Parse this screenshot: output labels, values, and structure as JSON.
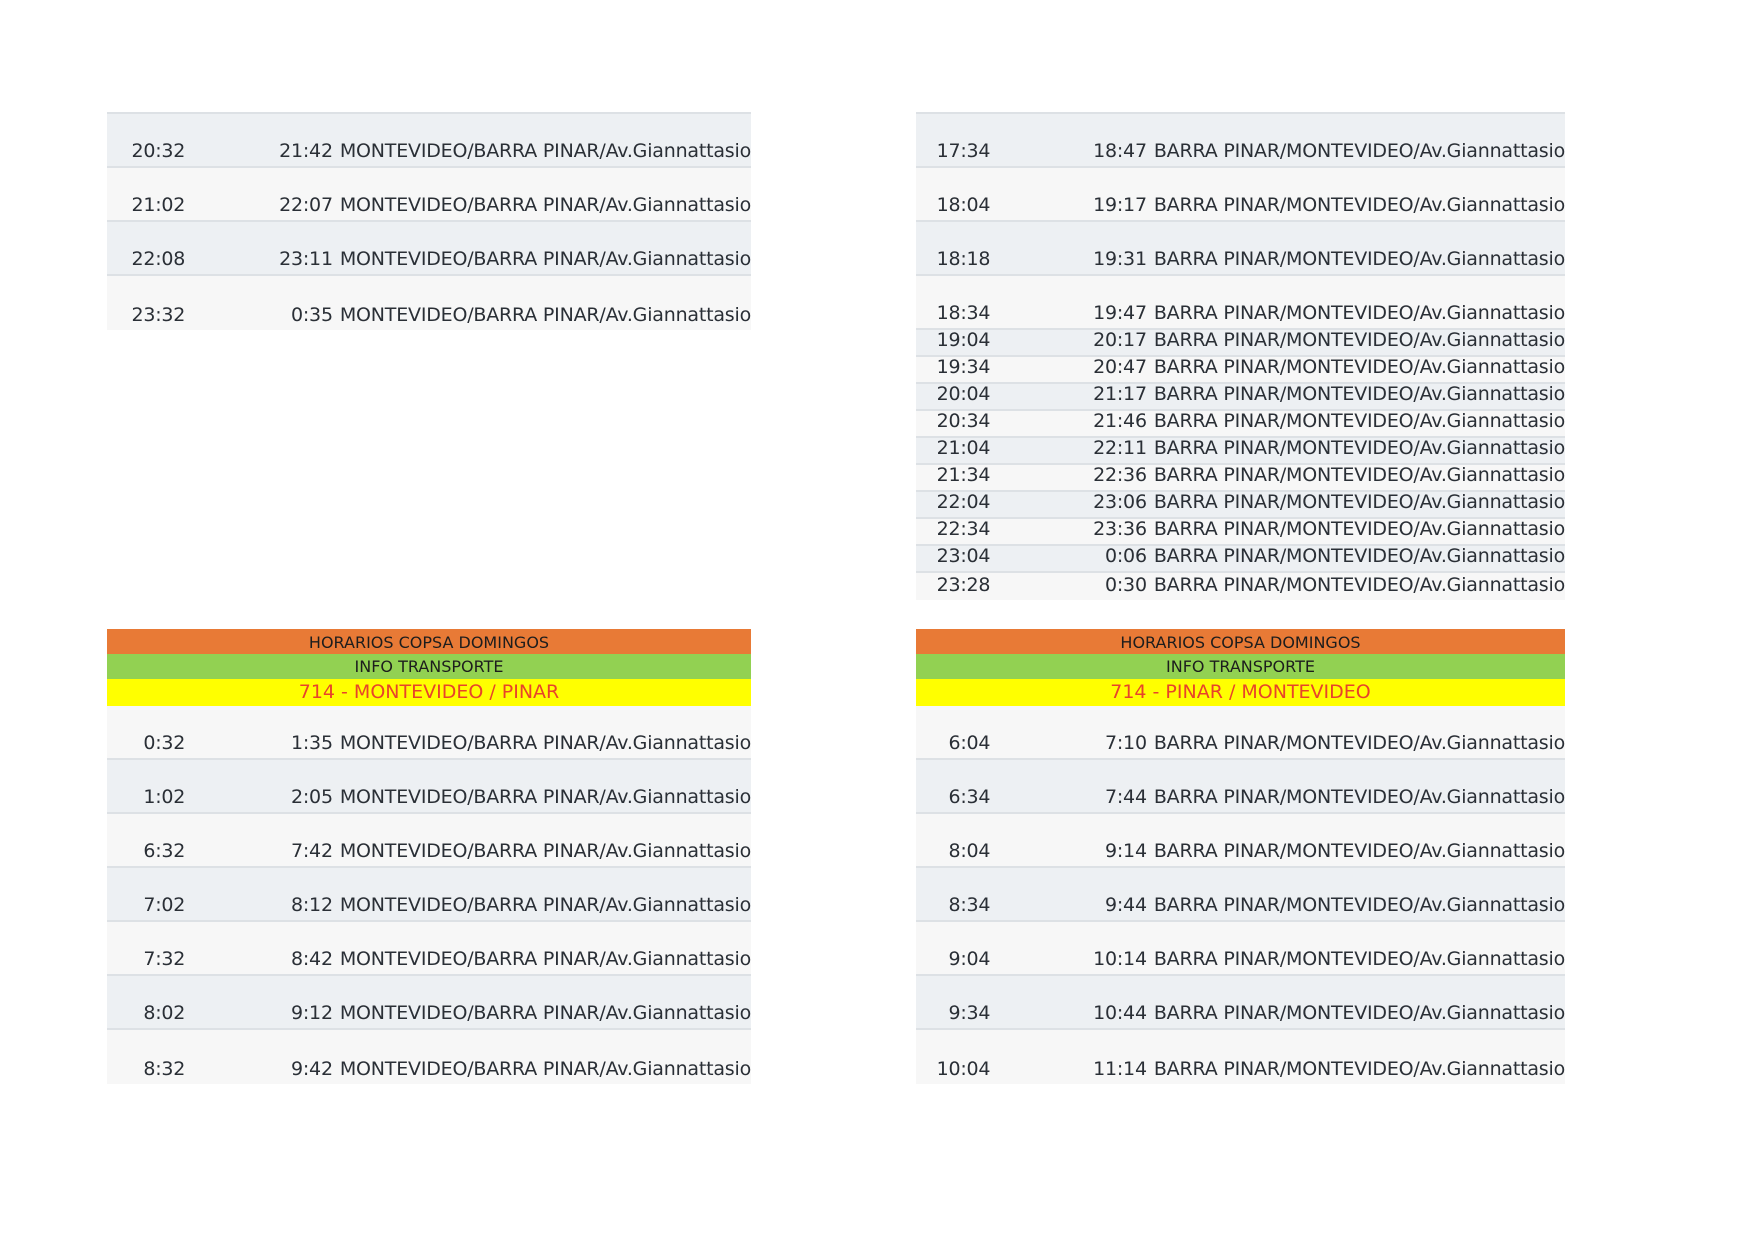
{
  "top_left": {
    "rows": [
      [
        "20:32",
        "21:42",
        "MONTEVIDEO/BARRA PINAR/Av.Giannattasio"
      ],
      [
        "21:02",
        "22:07",
        "MONTEVIDEO/BARRA PINAR/Av.Giannattasio"
      ],
      [
        "22:08",
        "23:11",
        "MONTEVIDEO/BARRA PINAR/Av.Giannattasio"
      ],
      [
        "23:32",
        "0:35",
        "MONTEVIDEO/BARRA PINAR/Av.Giannattasio"
      ]
    ]
  },
  "top_right": {
    "tall_rows": [
      [
        "17:34",
        "18:47",
        "BARRA PINAR/MONTEVIDEO/Av.Giannattasio"
      ],
      [
        "18:04",
        "19:17",
        "BARRA PINAR/MONTEVIDEO/Av.Giannattasio"
      ],
      [
        "18:18",
        "19:31",
        "BARRA PINAR/MONTEVIDEO/Av.Giannattasio"
      ],
      [
        "18:34",
        "19:47",
        "BARRA PINAR/MONTEVIDEO/Av.Giannattasio"
      ]
    ],
    "short_rows": [
      [
        "19:04",
        "20:17",
        "BARRA PINAR/MONTEVIDEO/Av.Giannattasio"
      ],
      [
        "19:34",
        "20:47",
        "BARRA PINAR/MONTEVIDEO/Av.Giannattasio"
      ],
      [
        "20:04",
        "21:17",
        "BARRA PINAR/MONTEVIDEO/Av.Giannattasio"
      ],
      [
        "20:34",
        "21:46",
        "BARRA PINAR/MONTEVIDEO/Av.Giannattasio"
      ],
      [
        "21:04",
        "22:11",
        "BARRA PINAR/MONTEVIDEO/Av.Giannattasio"
      ],
      [
        "21:34",
        "22:36",
        "BARRA PINAR/MONTEVIDEO/Av.Giannattasio"
      ],
      [
        "22:04",
        "23:06",
        "BARRA PINAR/MONTEVIDEO/Av.Giannattasio"
      ],
      [
        "22:34",
        "23:36",
        "BARRA PINAR/MONTEVIDEO/Av.Giannattasio"
      ],
      [
        "23:04",
        "0:06",
        "BARRA PINAR/MONTEVIDEO/Av.Giannattasio"
      ],
      [
        "23:28",
        "0:30",
        "BARRA PINAR/MONTEVIDEO/Av.Giannattasio"
      ]
    ]
  },
  "bottom_left": {
    "header": {
      "title": "HORARIOS COPSA DOMINGOS",
      "subtitle": "INFO TRANSPORTE",
      "route": "714 - MONTEVIDEO / PINAR",
      "title_color": "#e87a36",
      "subtitle_color": "#92d152",
      "route_color": "#ffff00"
    },
    "rows": [
      [
        "0:32",
        "1:35",
        "MONTEVIDEO/BARRA PINAR/Av.Giannattasio"
      ],
      [
        "1:02",
        "2:05",
        "MONTEVIDEO/BARRA PINAR/Av.Giannattasio"
      ],
      [
        "6:32",
        "7:42",
        "MONTEVIDEO/BARRA PINAR/Av.Giannattasio"
      ],
      [
        "7:02",
        "8:12",
        "MONTEVIDEO/BARRA PINAR/Av.Giannattasio"
      ],
      [
        "7:32",
        "8:42",
        "MONTEVIDEO/BARRA PINAR/Av.Giannattasio"
      ],
      [
        "8:02",
        "9:12",
        "MONTEVIDEO/BARRA PINAR/Av.Giannattasio"
      ],
      [
        "8:32",
        "9:42",
        "MONTEVIDEO/BARRA PINAR/Av.Giannattasio"
      ]
    ]
  },
  "bottom_right": {
    "header": {
      "title": "HORARIOS COPSA DOMINGOS",
      "subtitle": "INFO TRANSPORTE",
      "route": "714 - PINAR / MONTEVIDEO"
    },
    "rows": [
      [
        "6:04",
        "7:10",
        "BARRA PINAR/MONTEVIDEO/Av.Giannattasio"
      ],
      [
        "6:34",
        "7:44",
        "BARRA PINAR/MONTEVIDEO/Av.Giannattasio"
      ],
      [
        "8:04",
        "9:14",
        "BARRA PINAR/MONTEVIDEO/Av.Giannattasio"
      ],
      [
        "8:34",
        "9:44",
        "BARRA PINAR/MONTEVIDEO/Av.Giannattasio"
      ],
      [
        "9:04",
        "10:14",
        "BARRA PINAR/MONTEVIDEO/Av.Giannattasio"
      ],
      [
        "9:34",
        "10:44",
        "BARRA PINAR/MONTEVIDEO/Av.Giannattasio"
      ],
      [
        "10:04",
        "11:14",
        "BARRA PINAR/MONTEVIDEO/Av.Giannattasio"
      ]
    ]
  }
}
